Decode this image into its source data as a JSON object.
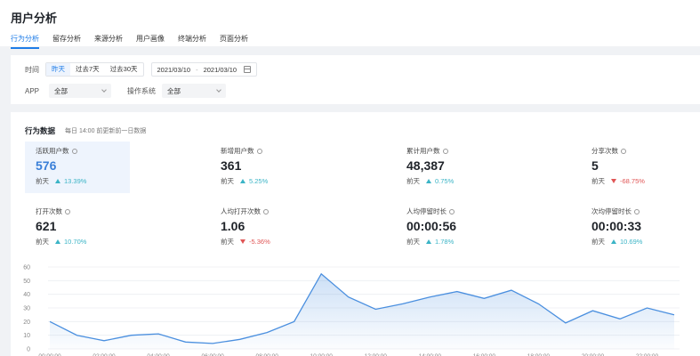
{
  "page_title": "用户分析",
  "tabs": [
    {
      "label": "行为分析",
      "active": true
    },
    {
      "label": "留存分析",
      "active": false
    },
    {
      "label": "来源分析",
      "active": false
    },
    {
      "label": "用户画像",
      "active": false
    },
    {
      "label": "终端分析",
      "active": false
    },
    {
      "label": "页面分析",
      "active": false
    }
  ],
  "filters": {
    "time_label": "时间",
    "time_options": [
      "昨天",
      "过去7天",
      "过去30天"
    ],
    "date_start": "2021/03/10",
    "date_sep": "-",
    "date_end": "2021/03/10",
    "app_label": "APP",
    "app_value": "全部",
    "os_label": "操作系统",
    "os_value": "全部"
  },
  "section": {
    "title": "行为数据",
    "subtitle": "每日 14:00 前更新前一日数据"
  },
  "metrics": [
    {
      "label": "活跃用户数",
      "value": "576",
      "cmp": "前天",
      "delta": "13.39%",
      "dir": "up"
    },
    {
      "label": "新增用户数",
      "value": "361",
      "cmp": "前天",
      "delta": "5.25%",
      "dir": "up"
    },
    {
      "label": "累计用户数",
      "value": "48,387",
      "cmp": "前天",
      "delta": "0.75%",
      "dir": "up"
    },
    {
      "label": "分享次数",
      "value": "5",
      "cmp": "前天",
      "delta": "-68.75%",
      "dir": "down"
    },
    {
      "label": "打开次数",
      "value": "621",
      "cmp": "前天",
      "delta": "10.70%",
      "dir": "up"
    },
    {
      "label": "人均打开次数",
      "value": "1.06",
      "cmp": "前天",
      "delta": "-5.36%",
      "dir": "down"
    },
    {
      "label": "人均停留时长",
      "value": "00:00:56",
      "cmp": "前天",
      "delta": "1.78%",
      "dir": "up"
    },
    {
      "label": "次均停留时长",
      "value": "00:00:33",
      "cmp": "前天",
      "delta": "10.69%",
      "dir": "up"
    }
  ],
  "colors": {
    "accent": "#1e7ce8",
    "up": "#3bb4c6",
    "down": "#e05555",
    "line": "#4a8fdf"
  },
  "chart_data": {
    "type": "area",
    "x": [
      "00:00:00",
      "01:00:00",
      "02:00:00",
      "03:00:00",
      "04:00:00",
      "05:00:00",
      "06:00:00",
      "07:00:00",
      "08:00:00",
      "09:00:00",
      "10:00:00",
      "11:00:00",
      "12:00:00",
      "13:00:00",
      "14:00:00",
      "15:00:00",
      "16:00:00",
      "17:00:00",
      "18:00:00",
      "19:00:00",
      "20:00:00",
      "21:00:00",
      "22:00:00",
      "23:00:00"
    ],
    "x_tick_labels": [
      "00:00:00",
      "02:00:00",
      "04:00:00",
      "06:00:00",
      "08:00:00",
      "10:00:00",
      "12:00:00",
      "14:00:00",
      "16:00:00",
      "18:00:00",
      "20:00:00",
      "22:00:00"
    ],
    "values": [
      20,
      10,
      6,
      10,
      11,
      5,
      4,
      7,
      12,
      20,
      55,
      38,
      29,
      33,
      38,
      42,
      37,
      43,
      33,
      19,
      28,
      22,
      30,
      25
    ],
    "yticks": [
      0,
      10,
      20,
      30,
      40,
      50,
      60
    ],
    "ylim": [
      0,
      60
    ],
    "grid": true,
    "title": "",
    "xlabel": "",
    "ylabel": ""
  }
}
